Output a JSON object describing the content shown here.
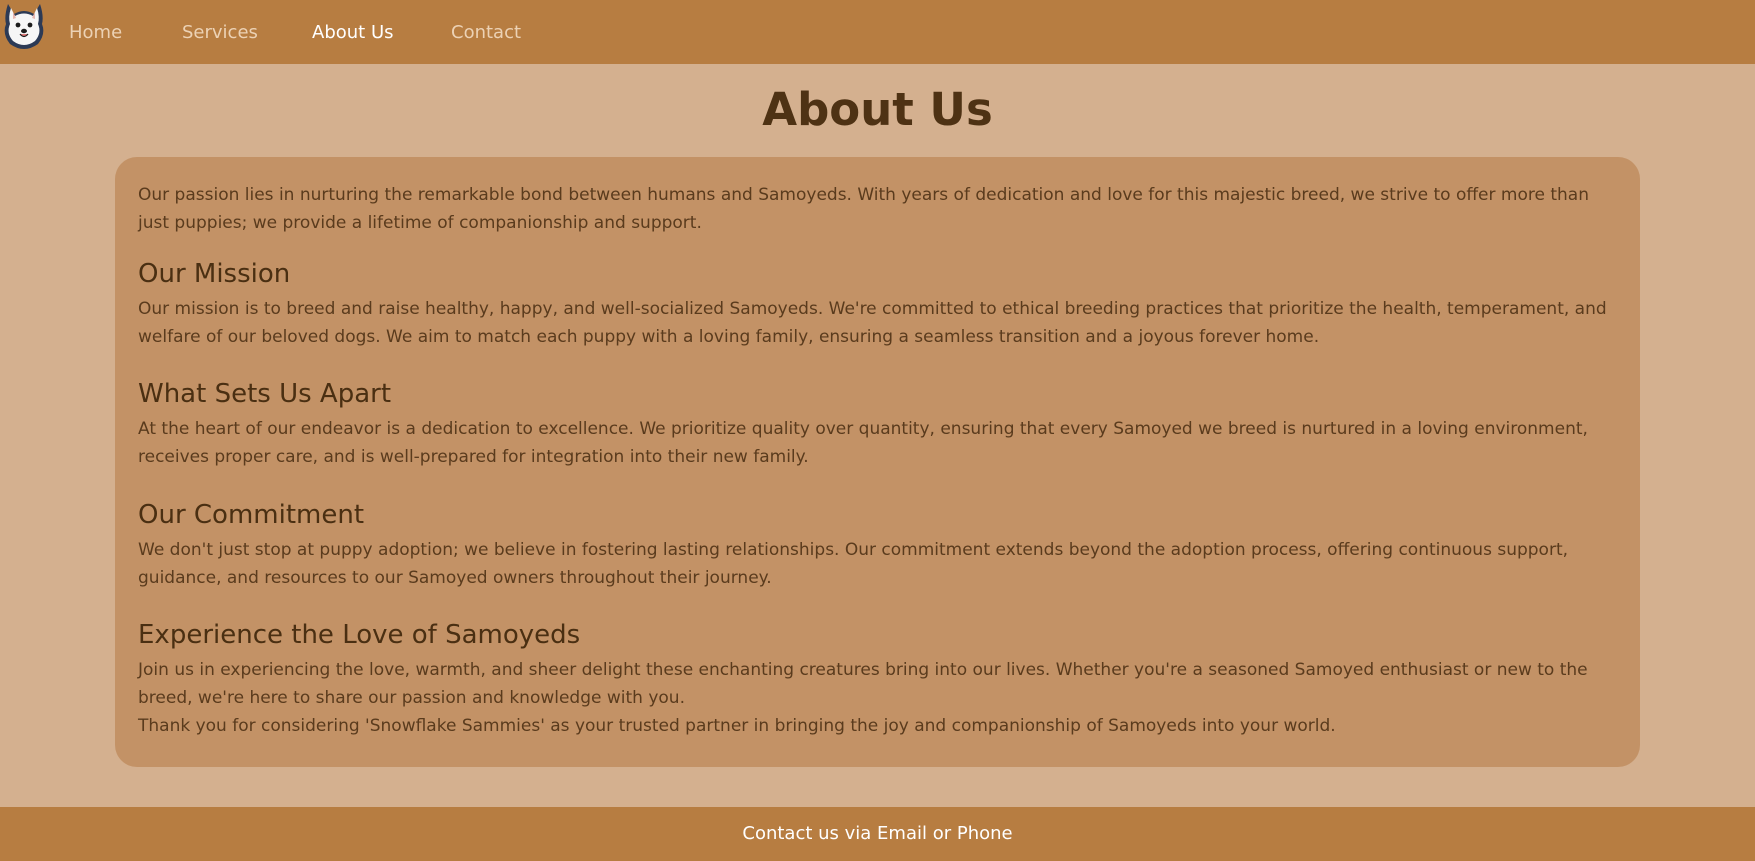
{
  "nav": {
    "items": [
      {
        "label": "Home"
      },
      {
        "label": "Services"
      },
      {
        "label": "About Us"
      },
      {
        "label": "Contact"
      }
    ],
    "active": "About Us",
    "logo_icon": "samoyed-logo-icon"
  },
  "page": {
    "title": "About Us",
    "intro": "Our passion lies in nurturing the remarkable bond between humans and Samoyeds. With years of dedication and love for this majestic breed, we strive to offer more than just puppies; we provide a lifetime of companionship and support.",
    "sections": [
      {
        "heading": "Our Mission",
        "body": "Our mission is to breed and raise healthy, happy, and well-socialized Samoyeds. We're committed to ethical breeding practices that prioritize the health, temperament, and welfare of our beloved dogs. We aim to match each puppy with a loving family, ensuring a seamless transition and a joyous forever home."
      },
      {
        "heading": "What Sets Us Apart",
        "body": "At the heart of our endeavor is a dedication to excellence. We prioritize quality over quantity, ensuring that every Samoyed we breed is nurtured in a loving environment, receives proper care, and is well-prepared for integration into their new family."
      },
      {
        "heading": "Our Commitment",
        "body": "We don't just stop at puppy adoption; we believe in fostering lasting relationships. Our commitment extends beyond the adoption process, offering continuous support, guidance, and resources to our Samoyed owners throughout their journey."
      },
      {
        "heading": "Experience the Love of Samoyeds",
        "body": "Join us in experiencing the love, warmth, and sheer delight these enchanting creatures bring into our lives. Whether you're a seasoned Samoyed enthusiast or new to the breed, we're here to share our passion and knowledge with you.",
        "closing": "Thank you for considering 'Snowflake Sammies' as your trusted partner in bringing the joy and companionship of Samoyeds into your world."
      }
    ]
  },
  "footer": {
    "text": "Contact us via Email or Phone"
  },
  "colors": {
    "nav_bg": "#b77d41",
    "page_bg": "#d4b08f",
    "card_bg": "#c39266",
    "heading": "#4a2f12",
    "text": "#5a3b1d"
  }
}
